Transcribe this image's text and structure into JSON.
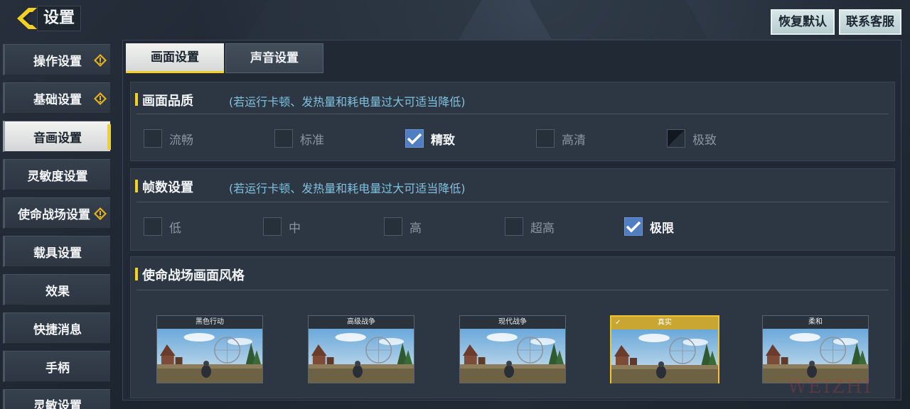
{
  "header": {
    "title": "设置",
    "restore_default": "恢复默认",
    "contact_service": "联系客服"
  },
  "sidebar": {
    "items": [
      {
        "label": "操作设置",
        "warning": true
      },
      {
        "label": "基础设置",
        "warning": true
      },
      {
        "label": "音画设置",
        "active": true
      },
      {
        "label": "灵敏度设置"
      },
      {
        "label": "使命战场设置",
        "warning": true
      },
      {
        "label": "载具设置"
      },
      {
        "label": "效果"
      },
      {
        "label": "快捷消息"
      },
      {
        "label": "手柄"
      },
      {
        "label": "灵敏设置"
      }
    ]
  },
  "tabs": [
    {
      "label": "画面设置",
      "active": true
    },
    {
      "label": "声音设置"
    }
  ],
  "quality": {
    "title": "画面品质",
    "hint": "(若运行卡顿、发热量和耗电量过大可适当降低)",
    "options": [
      "流畅",
      "标准",
      "精致",
      "高清",
      "极致"
    ],
    "selected": "精致"
  },
  "framerate": {
    "title": "帧数设置",
    "hint": "(若运行卡顿、发热量和耗电量过大可适当降低)",
    "options": [
      "低",
      "中",
      "高",
      "超高",
      "极限"
    ],
    "selected": "极限"
  },
  "style": {
    "title": "使命战场画面风格",
    "options": [
      "黑色行动",
      "高级战争",
      "现代战争",
      "真实",
      "柔和"
    ],
    "selected": "真实"
  },
  "colors": {
    "accent": "#f3d021",
    "checkbox": "#4f7fc2",
    "hint": "#7fc1de"
  },
  "watermark": "WEIZHI"
}
